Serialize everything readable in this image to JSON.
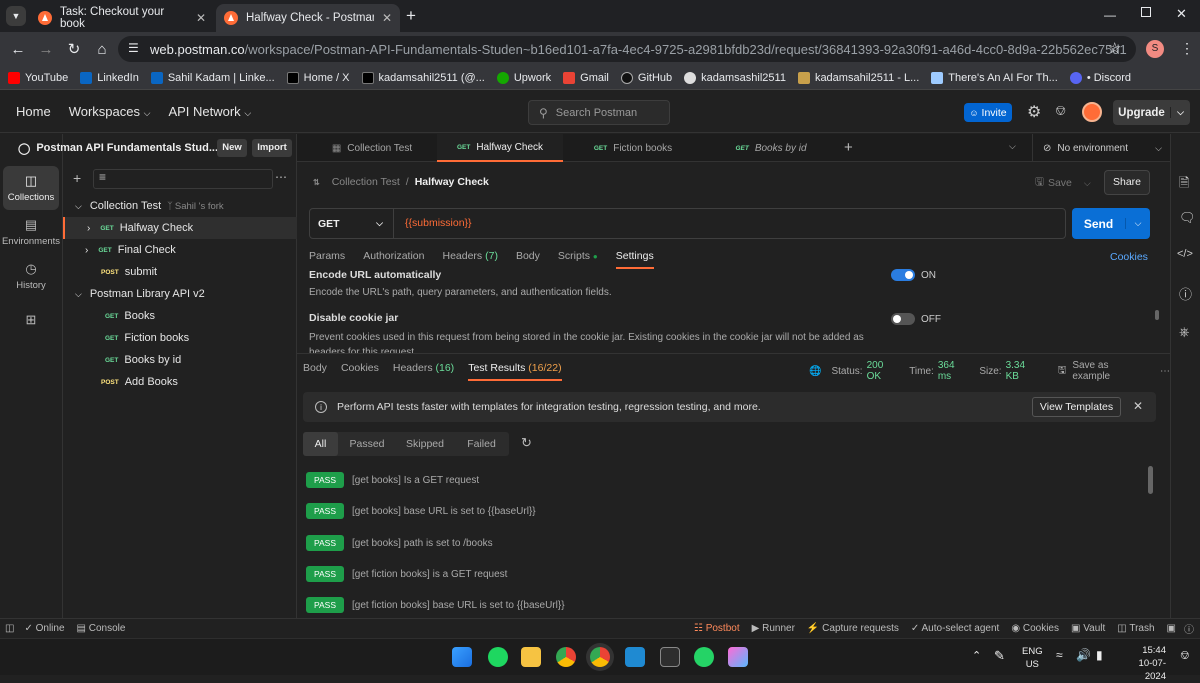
{
  "browser": {
    "tabs": [
      {
        "label": "Task: Checkout your book"
      },
      {
        "label": "Halfway Check - Postman API F"
      }
    ],
    "new_tab": "+",
    "url_domain": "web.postman.co",
    "url_path": "/workspace/Postman-API-Fundamentals-Studen~b16ed101-a7fa-4ec4-9725-a2981bfdb23d/request/36841393-92a30f91-a46d-4cc0-8d9a-22b562ec75d1",
    "profile_initial": "S",
    "bookmarks": [
      "YouTube",
      "LinkedIn",
      "Sahil Kadam | Linke...",
      "Home / X",
      "kadamsahil2511 (@...",
      "Upwork",
      "Gmail",
      "GitHub",
      "kadamsashil2511",
      "kadamsahil2511 - L...",
      "There's An AI For Th...",
      "• Discord"
    ]
  },
  "header": {
    "home": "Home",
    "workspaces": "Workspaces",
    "api_network": "API Network",
    "search_placeholder": "Search Postman",
    "invite": "Invite",
    "upgrade": "Upgrade"
  },
  "rail": {
    "collections": "Collections",
    "environments": "Environments",
    "history": "History"
  },
  "sidebar": {
    "workspace_name": "Postman API Fundamentals Stud...",
    "new": "New",
    "import": "Import",
    "tree": [
      {
        "label": "Collection Test",
        "fork": "Sahil 's fork"
      },
      {
        "method": "GET",
        "label": "Halfway Check"
      },
      {
        "method": "GET",
        "label": "Final Check"
      },
      {
        "method": "POST",
        "label": "submit"
      },
      {
        "label": "Postman Library API v2"
      },
      {
        "method": "GET",
        "label": "Books"
      },
      {
        "method": "GET",
        "label": "Fiction books"
      },
      {
        "method": "GET",
        "label": "Books by id"
      },
      {
        "method": "POST",
        "label": "Add Books"
      }
    ]
  },
  "request_tabs": [
    {
      "method": "",
      "label": "Collection Test"
    },
    {
      "method": "GET",
      "label": "Halfway Check"
    },
    {
      "method": "GET",
      "label": "Fiction books"
    },
    {
      "method": "GET",
      "label": "Books by id"
    }
  ],
  "environment": "No environment",
  "breadcrumb": {
    "parent": "Collection Test",
    "sep": "/",
    "current": "Halfway Check"
  },
  "save": "Save",
  "share": "Share",
  "request": {
    "method": "GET",
    "url": "{{submission}}",
    "send": "Send"
  },
  "req_subtabs": {
    "params": "Params",
    "authorization": "Authorization",
    "headers": "Headers",
    "headers_count": "(7)",
    "body": "Body",
    "scripts": "Scripts",
    "settings": "Settings",
    "cookies": "Cookies"
  },
  "settings": {
    "encode_title": "Encode URL automatically",
    "encode_desc": "Encode the URL's path, query parameters, and authentication fields.",
    "encode_state": "ON",
    "cookie_title": "Disable cookie jar",
    "cookie_desc": "Prevent cookies used in this request from being stored in the cookie jar. Existing cookies in the cookie jar will not be added as headers for this request.",
    "cookie_state": "OFF"
  },
  "response": {
    "tabs": {
      "body": "Body",
      "cookies": "Cookies",
      "headers": "Headers",
      "headers_count": "(16)",
      "test_results": "Test Results",
      "test_count": "(16/22)"
    },
    "status_label": "Status:",
    "status": "200 OK",
    "time_label": "Time:",
    "time": "364 ms",
    "size_label": "Size:",
    "size": "3.34 KB",
    "save_example": "Save as example"
  },
  "banner": {
    "text": "Perform API tests faster with templates for integration testing, regression testing, and more.",
    "button": "View Templates"
  },
  "filters": [
    "All",
    "Passed",
    "Skipped",
    "Failed"
  ],
  "results": [
    {
      "status": "PASS",
      "text": "[get books] Is a GET request"
    },
    {
      "status": "PASS",
      "text": "[get books] base URL is set to {{baseUrl}}"
    },
    {
      "status": "PASS",
      "text": "[get books] path is set to /books"
    },
    {
      "status": "PASS",
      "text": "[get fiction books] is a GET request"
    },
    {
      "status": "PASS",
      "text": "[get fiction books] base URL is set to {{baseUrl}}"
    }
  ],
  "statusbar": {
    "online": "Online",
    "console": "Console",
    "postbot": "Postbot",
    "runner": "Runner",
    "capture": "Capture requests",
    "autoselect": "Auto-select agent",
    "cookies": "Cookies",
    "vault": "Vault",
    "trash": "Trash"
  },
  "taskbar": {
    "lang": "ENG",
    "region": "US",
    "time": "15:44",
    "date": "10-07-2024"
  }
}
